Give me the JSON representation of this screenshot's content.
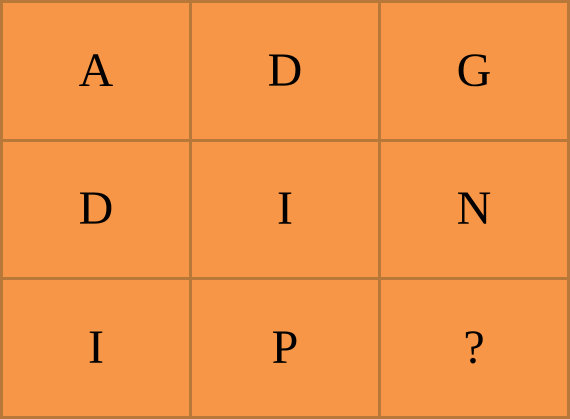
{
  "colors": {
    "cell_fill": "#f79646",
    "grid_line": "#b8783a",
    "text": "#000000"
  },
  "grid": {
    "rows": [
      [
        "A",
        "D",
        "G"
      ],
      [
        "D",
        "I",
        "N"
      ],
      [
        "I",
        "P",
        "?"
      ]
    ]
  }
}
